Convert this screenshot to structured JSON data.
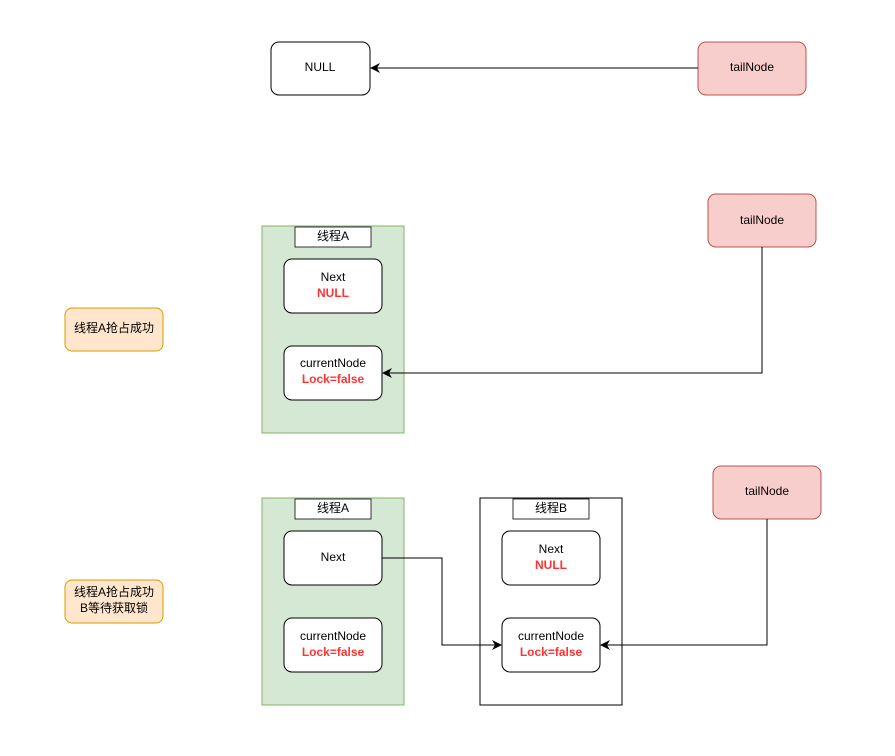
{
  "colors": {
    "tail_fill": "#f8cecc",
    "tail_stroke": "#b85450",
    "thread_a_fill": "#d5e8d4",
    "thread_a_stroke": "#82b366",
    "label_fill": "#ffe6cc",
    "label_stroke": "#d79b00",
    "highlight_text": "#ff3333"
  },
  "step1": {
    "null_node": "NULL",
    "tail_node": "tailNode"
  },
  "step2": {
    "label": "线程A抢占成功",
    "thread_a": {
      "title": "线程A",
      "next": "Next",
      "next_value": "NULL",
      "current": "currentNode",
      "current_value": "Lock=false"
    },
    "tail_node": "tailNode"
  },
  "step3": {
    "label_line1": "线程A抢占成功",
    "label_line2": "B等待获取锁",
    "thread_a": {
      "title": "线程A",
      "next": "Next",
      "current": "currentNode",
      "current_value": "Lock=false"
    },
    "thread_b": {
      "title": "线程B",
      "next": "Next",
      "next_value": "NULL",
      "current": "currentNode",
      "current_value": "Lock=false"
    },
    "tail_node": "tailNode"
  }
}
